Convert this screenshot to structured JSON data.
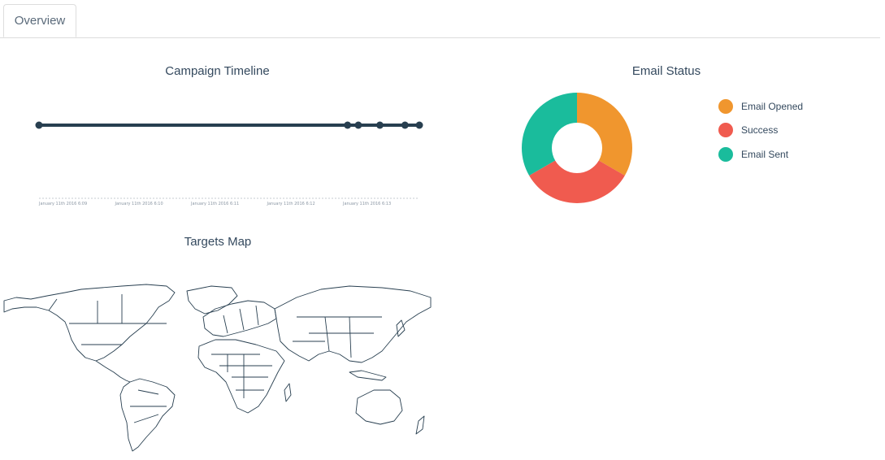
{
  "tabs": [
    {
      "label": "Overview",
      "active": true
    }
  ],
  "timeline": {
    "title": "Campaign Timeline",
    "tick_labels": [
      "January 11th 2016 6:09",
      "January 11th 2016 6:10",
      "January 11th 2016 6:11",
      "January 11th 2016 6:12",
      "January 11th 2016 6:13"
    ],
    "line_color": "#283f50"
  },
  "email_status": {
    "title": "Email Status",
    "legend": [
      {
        "label": "Email Opened",
        "color": "#f0962e"
      },
      {
        "label": "Success",
        "color": "#f05b4f"
      },
      {
        "label": "Email Sent",
        "color": "#1abc9c"
      }
    ]
  },
  "targets_map": {
    "title": "Targets Map",
    "stroke_color": "#283f50"
  },
  "chart_data": [
    {
      "type": "scatter",
      "title": "Campaign Timeline",
      "x": [
        "6:08.6",
        "6:12.9",
        "6:13.05",
        "6:13.35",
        "6:13.7",
        "6:13.9"
      ],
      "x_tick_labels": [
        "January 11th 2016 6:09",
        "January 11th 2016 6:10",
        "January 11th 2016 6:11",
        "January 11th 2016 6:12",
        "January 11th 2016 6:13"
      ],
      "x_minutes": [
        8.6,
        12.9,
        13.05,
        13.35,
        13.7,
        13.9
      ],
      "xlim": [
        8.6,
        13.9
      ]
    },
    {
      "type": "pie",
      "title": "Email Status",
      "categories": [
        "Email Opened",
        "Success",
        "Email Sent"
      ],
      "values": [
        1,
        1,
        1
      ],
      "colors": [
        "#f0962e",
        "#f05b4f",
        "#1abc9c"
      ],
      "donut": true
    }
  ]
}
